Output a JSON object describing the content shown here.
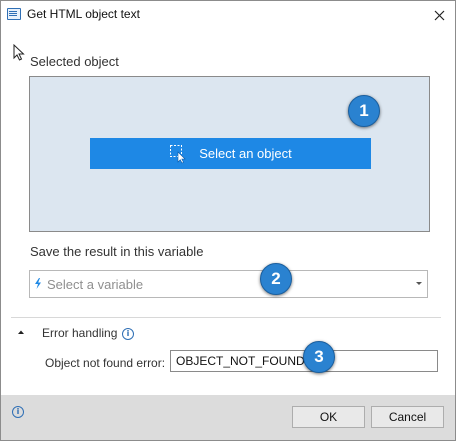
{
  "window": {
    "title": "Get HTML object text"
  },
  "selected_object": {
    "label": "Selected object",
    "button_label": "Select an object"
  },
  "result_variable": {
    "label": "Save the result in this variable",
    "placeholder": "Select a variable"
  },
  "error_handling": {
    "label": "Error handling",
    "expanded": true,
    "field_label": "Object not found error:",
    "field_value": "OBJECT_NOT_FOUND"
  },
  "badges": [
    "1",
    "2",
    "3"
  ],
  "footer": {
    "ok_label": "OK",
    "cancel_label": "Cancel"
  },
  "icons": {
    "app": "html-window-icon",
    "close": "close-icon",
    "select": "pick-element-icon",
    "variable": "bolt-icon",
    "collapse": "chevron-up-icon",
    "info": "info-icon"
  },
  "colors": {
    "accent": "#1e88e5",
    "badge": "#2a82d0",
    "selection_area": "#dce6f0",
    "footer": "#dcdcdc"
  }
}
